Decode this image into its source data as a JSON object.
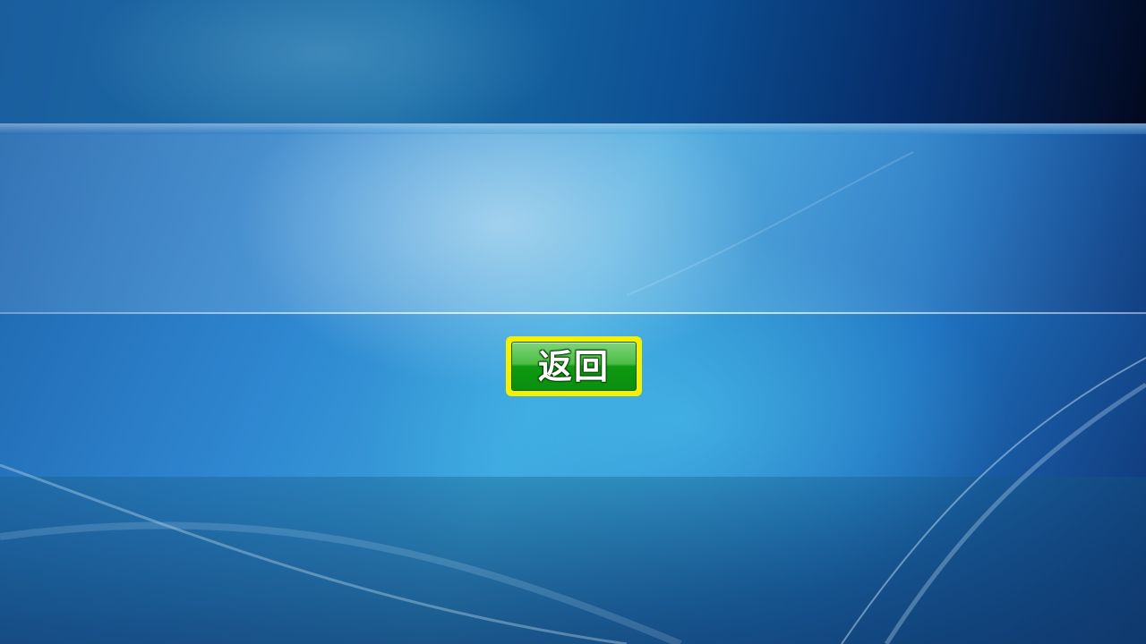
{
  "screen": {
    "background_colors": {
      "top": "#0c4f92",
      "middle": "#3aa3dc",
      "bottom": "#1b5f8c",
      "corner_dark": "#02091f"
    }
  },
  "back_button": {
    "label": "返回",
    "border_color": "#f4f000",
    "fill_color": "#0f9a12"
  }
}
